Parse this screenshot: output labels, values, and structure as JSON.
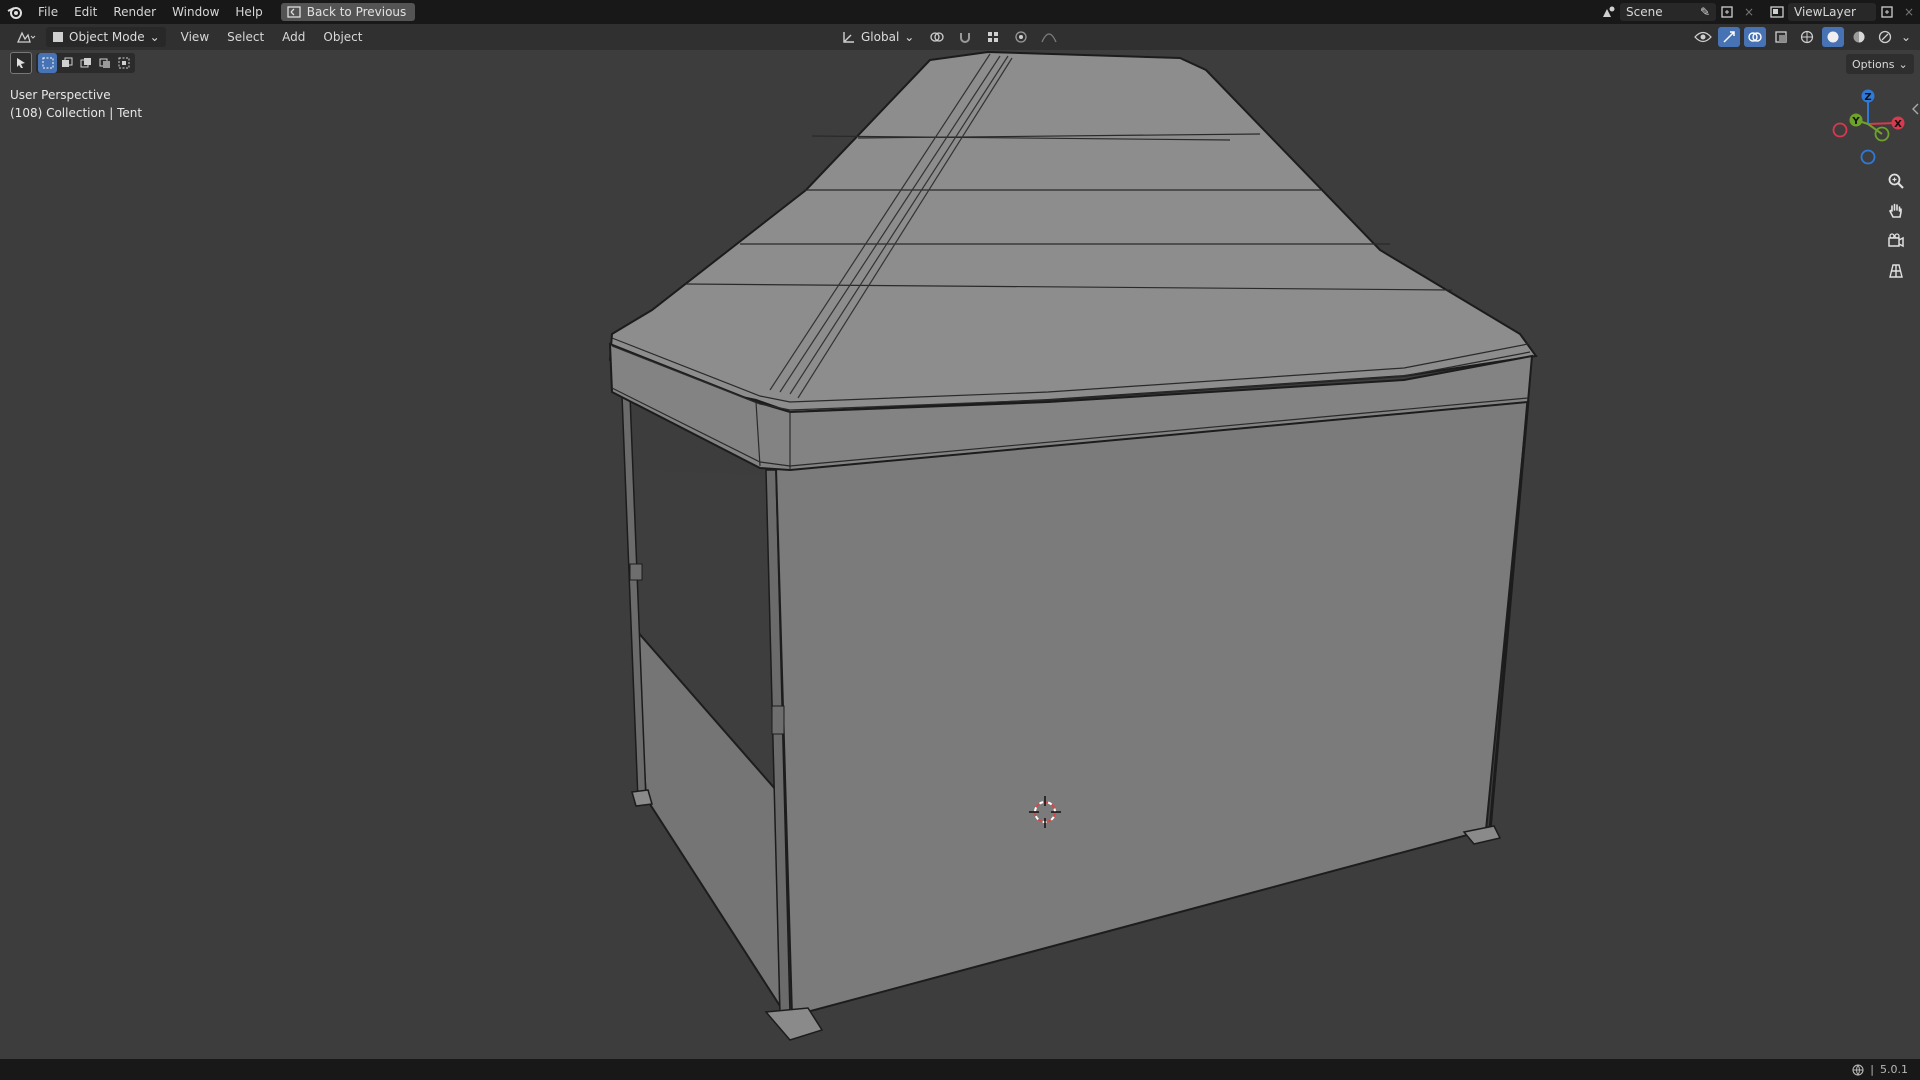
{
  "app": {
    "menu": [
      "File",
      "Edit",
      "Render",
      "Window",
      "Help"
    ],
    "back_button": "Back to Previous",
    "scene": "Scene",
    "view_layer": "ViewLayer"
  },
  "header": {
    "mode": "Object Mode",
    "menus": [
      "View",
      "Select",
      "Add",
      "Object"
    ],
    "transform_orientation": "Global",
    "options": "Options"
  },
  "viewport": {
    "perspective": "User Perspective",
    "collection_info": "(108) Collection | Tent",
    "gizmo_axes": [
      "Z",
      "Y",
      "X"
    ]
  },
  "status": {
    "version": "5.0.1"
  },
  "colors": {
    "accent": "#4772b3",
    "axis_x": "#d9394e",
    "axis_y": "#6fa229",
    "axis_z": "#2f7ad8",
    "viewport_bg": "#3d3d3d"
  },
  "icons": {
    "logo": "blender-logo-icon",
    "zoom": "zoom-icon",
    "pan": "hand-pan-icon",
    "camera": "camera-icon",
    "grid": "grid-icon"
  }
}
